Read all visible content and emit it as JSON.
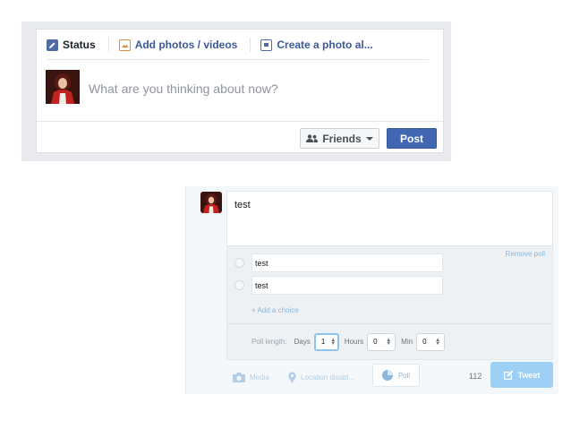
{
  "facebook": {
    "tabs": [
      {
        "label": "Status",
        "icon": "pencil-icon"
      },
      {
        "label": "Add photos / videos",
        "icon": "photo-icon"
      },
      {
        "label": "Create a photo al...",
        "icon": "album-icon"
      }
    ],
    "composer_placeholder": "What are you thinking about now?",
    "audience_label": "Friends",
    "post_label": "Post",
    "colors": {
      "link": "#3b5998",
      "button": "#4267b2"
    }
  },
  "twitter": {
    "tweet_text": "test",
    "remove_poll_label": "Remove poll",
    "choices": [
      "test",
      "test"
    ],
    "add_choice_label": "+ Add a choice",
    "poll_length": {
      "label": "Poll length:",
      "days_label": "Days",
      "days_value": "1",
      "hours_label": "Hours",
      "hours_value": "0",
      "min_label": "Min",
      "min_value": "0"
    },
    "toolbar": {
      "media_label": "Media",
      "location_label": "Location disabl...",
      "poll_label": "Poll"
    },
    "char_count": "112",
    "tweet_label": "Tweet",
    "colors": {
      "accent": "#9ed0f5",
      "link": "#8bb8dc"
    }
  }
}
